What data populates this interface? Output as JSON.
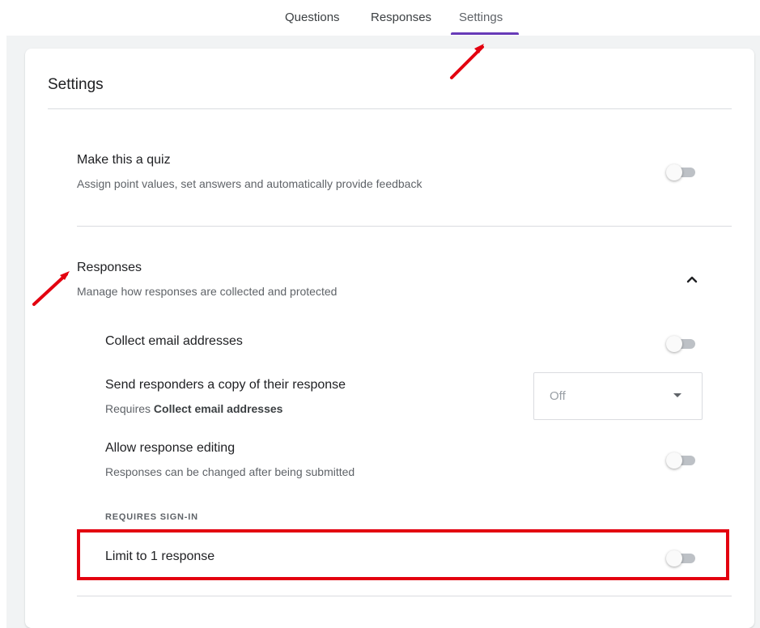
{
  "tabs": {
    "questions": "Questions",
    "responses": "Responses",
    "settings": "Settings",
    "active": "settings"
  },
  "settings": {
    "title": "Settings",
    "quiz": {
      "title": "Make this a quiz",
      "subtitle": "Assign point values, set answers and automatically provide feedback",
      "enabled": false
    },
    "responses": {
      "title": "Responses",
      "subtitle": "Manage how responses are collected and protected",
      "expanded": true,
      "collect_email": {
        "title": "Collect email addresses",
        "enabled": false
      },
      "send_copy": {
        "title": "Send responders a copy of their response",
        "subtitle_prefix": "Requires ",
        "subtitle_bold": "Collect email addresses",
        "selected": "Off"
      },
      "allow_editing": {
        "title": "Allow response editing",
        "subtitle": "Responses can be changed after being submitted",
        "enabled": false
      },
      "requires_signin_label": "REQUIRES SIGN-IN",
      "limit_one": {
        "title": "Limit to 1 response",
        "enabled": false
      }
    }
  },
  "colors": {
    "accent": "#673ab7",
    "annotation_red": "#e3000f",
    "toggle_track_off": "#bdc1c6"
  }
}
